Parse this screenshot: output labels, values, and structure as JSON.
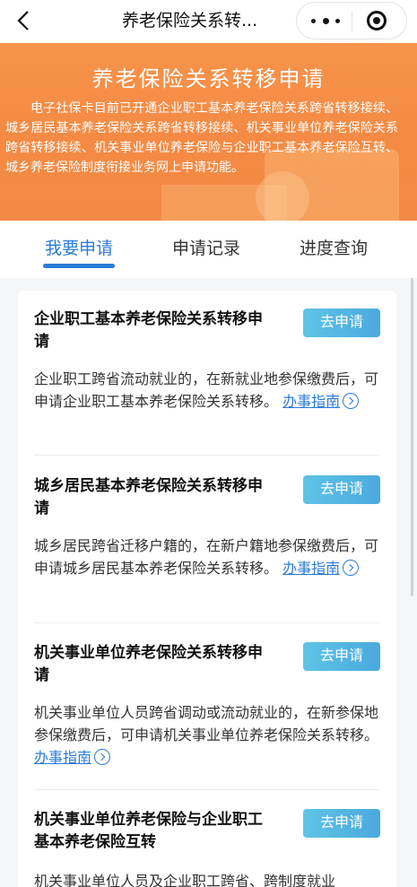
{
  "navbar": {
    "title": "养老保险关系转..."
  },
  "banner": {
    "title": "养老保险关系转移申请",
    "description": "电子社保卡目前已开通企业职工基本养老保险关系跨省转移接续、城乡居民基本养老保险关系跨省转移接续、机关事业单位养老保险关系跨省转移接续、机关事业单位养老保险与企业职工基本养老保险互转、城乡养老保险制度衔接业务网上申请功能。"
  },
  "tabs": [
    {
      "label": "我要申请",
      "active": true
    },
    {
      "label": "申请记录",
      "active": false
    },
    {
      "label": "进度查询",
      "active": false
    }
  ],
  "items": [
    {
      "title": "企业职工基本养老保险关系转移申请",
      "button": "去申请",
      "desc": "企业职工跨省流动就业的，在新就业地参保缴费后，可申请企业职工基本养老保险关系转移。",
      "guide": "办事指南"
    },
    {
      "title": "城乡居民基本养老保险关系转移申请",
      "button": "去申请",
      "desc": "城乡居民跨省迁移户籍的，在新户籍地参保缴费后，可申请城乡居民基本养老保险关系转移。",
      "guide": "办事指南"
    },
    {
      "title": "机关事业单位养老保险关系转移申请",
      "button": "去申请",
      "desc": "机关事业单位人员跨省调动或流动就业的，在新参保地参保缴费后，可申请机关事业单位养老保险关系转移。",
      "guide": "办事指南"
    },
    {
      "title": "机关事业单位养老保险与企业职工基本养老保险互转",
      "button": "去申请",
      "desc": "机关事业单位人员及企业职工跨省、跨制度就业"
    }
  ],
  "colors": {
    "banner": "#f48a44",
    "accent": "#2b7bd8",
    "button": "#4aa9de"
  },
  "icons": [
    "back-icon",
    "more-icon",
    "close-mini-program-icon",
    "chevron-right-circle-icon"
  ]
}
